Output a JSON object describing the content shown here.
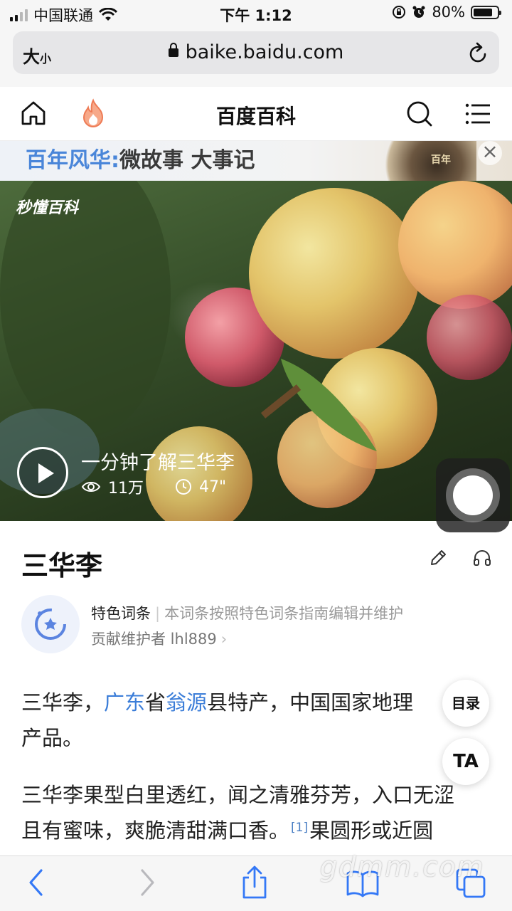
{
  "status_bar": {
    "carrier": "中国联通",
    "time": "下午 1:12",
    "battery": "80%",
    "battery_level": 0.8,
    "icons": [
      "signal-icon",
      "wifi-icon",
      "orientation-lock-icon",
      "alarm-icon",
      "battery-icon"
    ]
  },
  "url_bar": {
    "size_big": "大",
    "size_small": "小",
    "url": "baike.baidu.com",
    "icons": [
      "lock-icon",
      "reload-icon"
    ]
  },
  "header": {
    "title": "百度百科",
    "icons": [
      "home-icon",
      "hot-flame-icon",
      "search-icon",
      "menu-icon"
    ]
  },
  "banner": {
    "highlight": "百年风华:",
    "text": "微故事 大事记",
    "art_text": "百年",
    "close": "×"
  },
  "video": {
    "logo": "秒懂百科",
    "title": "一分钟了解三华李",
    "views": "11万",
    "duration": "47\"",
    "icons": [
      "play-icon",
      "eye-icon",
      "clock-icon"
    ]
  },
  "article": {
    "title": "三华李",
    "tools": [
      "edit-pencil-icon",
      "headphones-icon"
    ],
    "feature": {
      "tag": "特色词条",
      "description": "本词条按照特色词条指南编辑并维护",
      "contributor": "贡献维护者 lhl889",
      "chevron": "›"
    },
    "para1": {
      "p1": "三华李，",
      "link1": "广东",
      "p2": "省",
      "link2": "翁源",
      "p3": "县特产，中国国家地理",
      "p4": "产品。"
    },
    "para2": {
      "line1": "三华李果型白里透红，闻之清雅芬芳，入口无涩",
      "line2a": "且有蜜味，爽脆清甜满口香。",
      "ref": "[1]",
      "line2b": "果圆形或近圆"
    }
  },
  "floating": {
    "toc": "目录",
    "ta": "TA"
  },
  "toolbar": {
    "icons": [
      "back-icon",
      "forward-icon",
      "share-icon",
      "bookmarks-icon",
      "tabs-icon"
    ]
  },
  "watermark": "gdmm.com"
}
